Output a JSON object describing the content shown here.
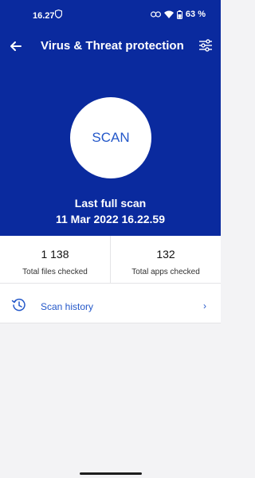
{
  "status_bar": {
    "time": "16.27",
    "battery": "63 %"
  },
  "header": {
    "title": "Virus & Threat protection",
    "back_icon": "arrow-left-icon",
    "filter_icon": "sliders-icon"
  },
  "scan": {
    "button_label": "SCAN",
    "last_scan_label": "Last full scan",
    "last_scan_date": "11 Mar 2022 16.22.59"
  },
  "stats": [
    {
      "value": "1 138",
      "label": "Total files checked"
    },
    {
      "value": "132",
      "label": "Total apps checked"
    }
  ],
  "history": {
    "label": "Scan history",
    "icon": "history-icon",
    "chevron": "›"
  },
  "colors": {
    "primary": "#0a2a9e",
    "accent": "#2458c9",
    "background": "#f3f3f5"
  }
}
